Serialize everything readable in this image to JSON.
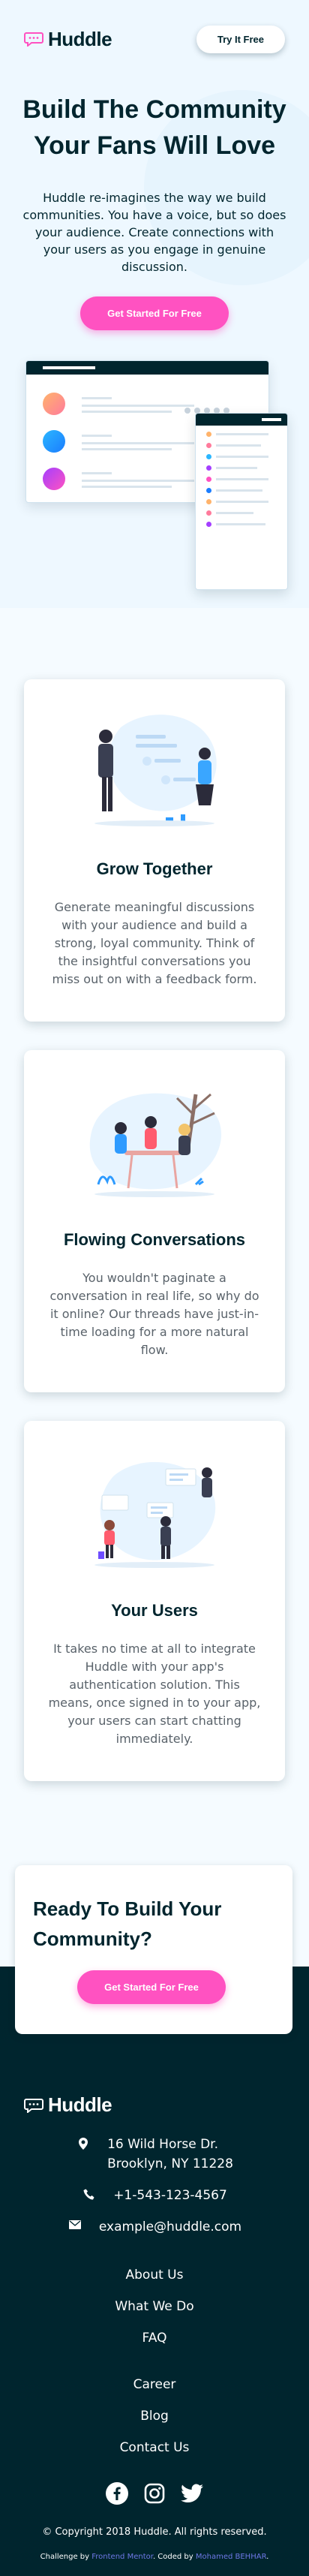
{
  "brand": {
    "name": "Huddle"
  },
  "header": {
    "cta_label": "Try It Free"
  },
  "hero": {
    "title": "Build The Community Your Fans Will Love",
    "text": "Huddle re-imagines the way we build communities. You have a voice, but so does your audience. Create connections with your users as you engage in genuine discussion.",
    "cta_label": "Get Started For Free"
  },
  "features": [
    {
      "title": "Grow Together",
      "text": "Generate meaningful discussions with your audience and build a strong, loyal community. Think of the insightful conversations you miss out on with a feedback form."
    },
    {
      "title": "Flowing Conversations",
      "text": "You wouldn't paginate a conversation in real life, so why do it online? Our threads have just-in-time loading for a more natural flow."
    },
    {
      "title": "Your Users",
      "text": "It takes no time at all to integrate Huddle with your app's authentication solution. This means, once signed in to your app, your users can start chatting immediately."
    }
  ],
  "cta": {
    "title": "Ready To Build Your Community?",
    "button_label": "Get Started For Free"
  },
  "footer": {
    "address_line1": "16 Wild Horse Dr.",
    "address_line2": "Brooklyn, NY 11228",
    "phone": "+1-543-123-4567",
    "email": "example@huddle.com",
    "links_primary": [
      "About Us",
      "What We Do",
      "FAQ"
    ],
    "links_secondary": [
      "Career",
      "Blog",
      "Contact Us"
    ],
    "social_icons": [
      "facebook-icon",
      "instagram-icon",
      "twitter-icon"
    ],
    "copyright": "© Copyright 2018 Huddle. All rights reserved.",
    "attribution_prefix": "Challenge by",
    "attribution_link1": "Frontend Mentor",
    "attribution_mid": ". Coded by",
    "attribution_link2": "Mohamed BEHHAR",
    "attribution_suffix": "."
  },
  "colors": {
    "dark": "#00252e",
    "pink": "#ff52c1",
    "hero_bg": "#eef8ff",
    "link_blue": "#6e78e6"
  }
}
